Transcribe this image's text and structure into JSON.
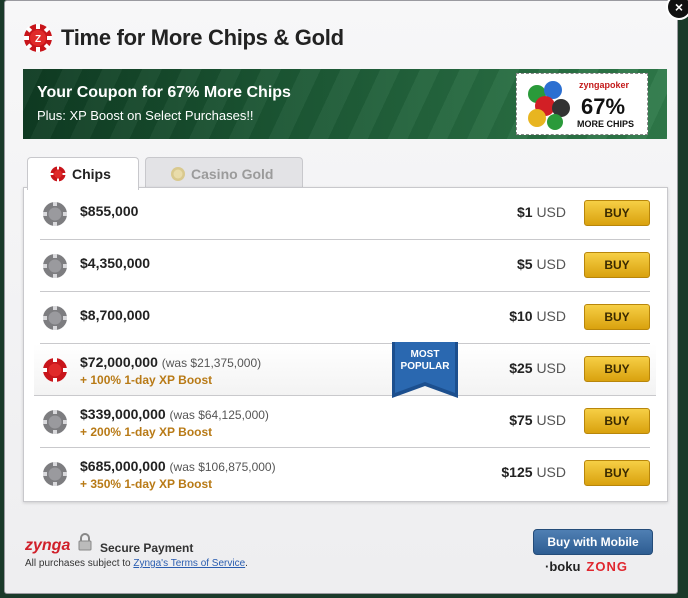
{
  "dialog": {
    "title": "Time for More Chips & Gold",
    "close_label": "×"
  },
  "banner": {
    "title": "Your Coupon for 67% More Chips",
    "subtitle": "Plus: XP Boost on Select Purchases!!",
    "coupon": {
      "brand": "zyngapoker",
      "percent": "67%",
      "label": "MORE CHIPS"
    }
  },
  "tabs": [
    {
      "label": "Chips",
      "active": true
    },
    {
      "label": "Casino Gold",
      "active": false
    }
  ],
  "packages": [
    {
      "amount": "$855,000",
      "was": "",
      "boost": "",
      "price": "$1",
      "currency": "USD",
      "buy_label": "BUY"
    },
    {
      "amount": "$4,350,000",
      "was": "",
      "boost": "",
      "price": "$5",
      "currency": "USD",
      "buy_label": "BUY"
    },
    {
      "amount": "$8,700,000",
      "was": "",
      "boost": "",
      "price": "$10",
      "currency": "USD",
      "buy_label": "BUY"
    },
    {
      "amount": "$72,000,000",
      "was": "(was $21,375,000)",
      "boost": "+ 100% 1-day XP Boost",
      "price": "$25",
      "currency": "USD",
      "buy_label": "BUY"
    },
    {
      "amount": "$339,000,000",
      "was": "(was $64,125,000)",
      "boost": "+ 200% 1-day XP Boost",
      "price": "$75",
      "currency": "USD",
      "buy_label": "BUY"
    },
    {
      "amount": "$685,000,000",
      "was": "(was $106,875,000)",
      "boost": "+ 350% 1-day XP Boost",
      "price": "$125",
      "currency": "USD",
      "buy_label": "BUY"
    }
  ],
  "ribbon": {
    "line1": "MOST",
    "line2": "POPULAR"
  },
  "footer": {
    "brand": "zynga",
    "secure": "Secure Payment",
    "terms_prefix": "All purchases subject to ",
    "terms_link": "Zynga's Terms of Service",
    "terms_suffix": ".",
    "mobile_button": "Buy with Mobile",
    "provider1": "boku",
    "provider2": "ZONG"
  },
  "colors": {
    "chip_red": "#c8151b",
    "chip_gray": "#7d7d80",
    "buy_gold": "#e8b520",
    "ribbon_blue": "#1c4f8e"
  }
}
